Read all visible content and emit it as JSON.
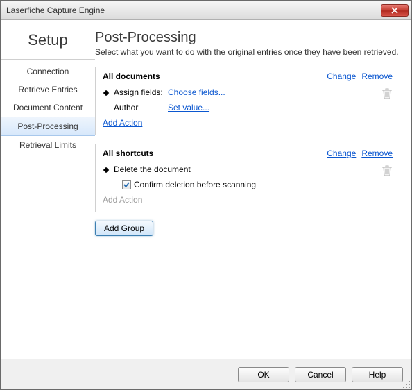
{
  "window": {
    "title": "Laserfiche Capture Engine"
  },
  "sidebar": {
    "title": "Setup",
    "items": [
      {
        "label": "Connection"
      },
      {
        "label": "Retrieve Entries"
      },
      {
        "label": "Document Content"
      },
      {
        "label": "Post-Processing"
      },
      {
        "label": "Retrieval Limits"
      }
    ],
    "selected": 3
  },
  "page": {
    "title": "Post-Processing",
    "description": "Select what you want to do with the original entries once they have been retrieved."
  },
  "groups": [
    {
      "name": "All documents",
      "change": "Change",
      "remove": "Remove",
      "action_label": "Assign fields:",
      "action_link": "Choose fields...",
      "sub_label": "Author",
      "sub_link": "Set value...",
      "add_action": "Add Action"
    },
    {
      "name": "All shortcuts",
      "change": "Change",
      "remove": "Remove",
      "action_label": "Delete the document",
      "checkbox_label": "Confirm deletion before scanning",
      "add_action": "Add Action"
    }
  ],
  "buttons": {
    "add_group": "Add Group",
    "ok": "OK",
    "cancel": "Cancel",
    "help": "Help"
  }
}
